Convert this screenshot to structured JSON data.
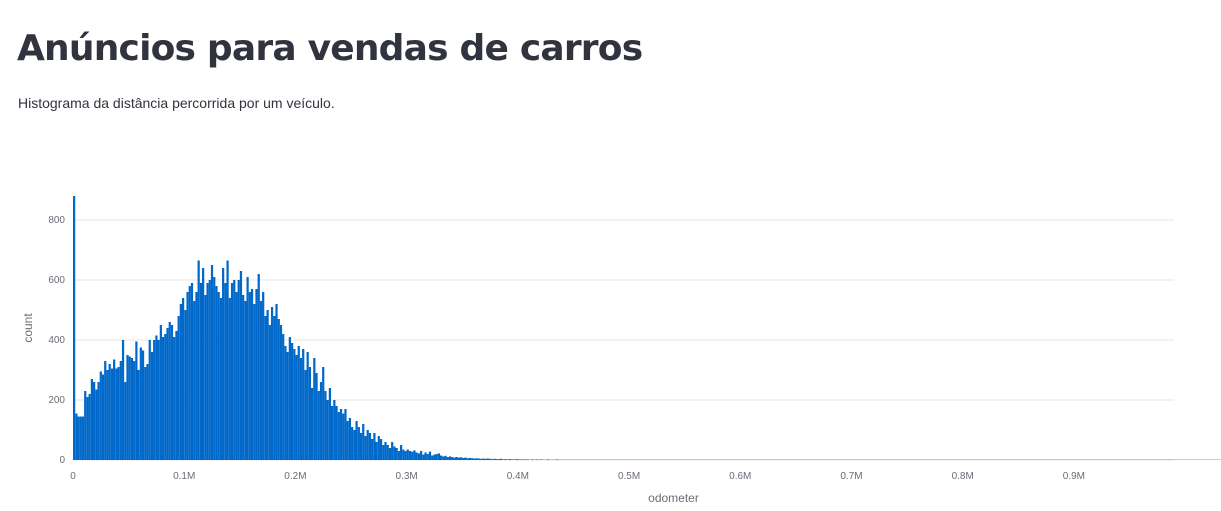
{
  "page": {
    "title": "Anúncios para vendas de carros",
    "caption": "Histograma da distância percorrida por um veículo."
  },
  "colors": {
    "bar": "#0068c9",
    "grid": "#e6e6ea",
    "text": "#31333f",
    "axis_text": "#6b6d76"
  },
  "chart_data": {
    "type": "bar",
    "title": "",
    "xlabel": "odometer",
    "ylabel": "count",
    "xlim": [
      0,
      990000
    ],
    "ylim": [
      0,
      880
    ],
    "grid": true,
    "x_ticks": [
      0,
      100000,
      200000,
      300000,
      400000,
      500000,
      600000,
      700000,
      800000,
      900000
    ],
    "x_tick_labels": [
      "0",
      "0.1M",
      "0.2M",
      "0.3M",
      "0.4M",
      "0.5M",
      "0.6M",
      "0.7M",
      "0.8M",
      "0.9M"
    ],
    "y_ticks": [
      0,
      200,
      400,
      600,
      800
    ],
    "y_tick_labels": [
      "0",
      "200",
      "400",
      "600",
      "800"
    ],
    "bin_width": 2000,
    "bin_start": 0,
    "values": [
      880,
      155,
      145,
      145,
      145,
      230,
      210,
      220,
      270,
      260,
      235,
      260,
      295,
      285,
      330,
      300,
      320,
      305,
      335,
      305,
      310,
      330,
      400,
      260,
      350,
      345,
      340,
      330,
      395,
      300,
      375,
      365,
      310,
      320,
      400,
      360,
      400,
      415,
      400,
      450,
      410,
      420,
      440,
      460,
      450,
      410,
      430,
      480,
      520,
      540,
      500,
      560,
      580,
      590,
      530,
      560,
      665,
      590,
      640,
      550,
      590,
      600,
      650,
      610,
      580,
      560,
      540,
      640,
      590,
      665,
      540,
      590,
      600,
      560,
      600,
      630,
      550,
      530,
      610,
      560,
      570,
      520,
      570,
      620,
      530,
      560,
      480,
      500,
      450,
      510,
      480,
      520,
      470,
      450,
      420,
      380,
      360,
      410,
      390,
      370,
      350,
      380,
      340,
      370,
      300,
      360,
      310,
      240,
      340,
      290,
      230,
      260,
      310,
      230,
      200,
      240,
      180,
      200,
      180,
      160,
      170,
      155,
      170,
      130,
      140,
      110,
      100,
      130,
      110,
      90,
      120,
      80,
      100,
      90,
      70,
      90,
      60,
      80,
      70,
      50,
      60,
      50,
      40,
      60,
      45,
      40,
      30,
      50,
      35,
      30,
      35,
      30,
      28,
      32,
      25,
      22,
      30,
      18,
      25,
      20,
      28,
      15,
      18,
      20,
      22,
      15,
      12,
      14,
      10,
      12,
      10,
      8,
      10,
      8,
      9,
      7,
      8,
      6,
      7,
      6,
      5,
      6,
      5,
      4,
      5,
      4,
      5,
      4,
      3,
      4,
      3,
      3,
      4,
      2,
      3,
      2,
      3,
      2,
      2,
      3,
      2,
      2,
      2,
      2,
      2,
      1,
      2,
      1,
      2,
      1,
      2,
      1,
      1,
      2,
      1,
      1,
      1,
      2,
      1,
      1,
      1,
      1,
      1,
      1,
      1,
      1,
      1,
      1,
      1,
      1,
      1,
      1,
      1,
      1,
      1,
      1,
      1,
      1,
      1,
      1,
      1,
      1,
      1,
      1,
      1,
      1,
      1,
      1,
      1,
      1,
      1,
      1,
      1,
      1,
      1,
      1,
      1,
      1,
      1,
      1,
      1,
      1,
      1,
      1,
      1,
      1,
      1,
      1,
      1,
      1,
      1,
      1,
      1,
      1,
      1,
      1,
      1,
      1,
      1,
      1,
      1,
      1,
      1,
      1,
      1,
      1,
      1,
      1,
      1,
      1,
      1,
      1,
      1,
      1,
      1,
      1,
      1,
      1,
      1,
      1,
      1,
      1,
      1,
      1,
      1,
      1,
      1,
      1,
      1,
      1,
      1,
      1,
      1,
      1,
      1,
      1,
      1,
      1,
      1,
      1,
      1,
      1,
      1,
      1,
      1,
      1,
      1,
      1,
      1,
      1,
      1,
      1,
      1,
      1,
      1,
      1,
      1,
      1,
      1,
      1,
      1,
      1,
      1,
      1,
      1,
      1,
      1,
      1,
      1,
      1,
      1,
      1,
      1,
      1,
      1,
      1,
      1,
      1,
      1,
      1,
      1,
      1,
      1,
      1,
      1,
      1,
      1,
      1,
      1,
      1,
      1,
      1,
      1,
      1,
      1,
      1,
      1,
      1,
      1,
      1,
      1,
      1,
      1,
      1,
      1,
      1,
      1,
      1,
      1,
      1,
      1,
      1,
      1,
      1,
      1,
      1,
      1,
      1,
      1,
      1,
      1,
      1,
      1,
      1,
      1,
      1,
      1,
      1,
      1,
      1,
      1,
      1,
      1,
      1,
      1,
      1,
      1,
      1,
      1,
      1,
      1,
      1,
      1,
      1,
      1,
      1,
      1,
      1,
      1,
      1,
      1,
      1,
      1,
      1,
      1,
      1,
      1,
      1,
      1,
      1,
      1,
      1,
      1,
      1,
      1,
      1,
      1,
      1,
      1,
      1,
      1,
      1,
      1,
      1,
      1,
      1,
      1,
      1,
      1,
      1,
      1,
      1,
      1,
      1,
      1,
      1,
      1,
      1,
      1,
      1,
      1,
      1,
      1,
      1,
      1,
      1,
      1,
      1,
      1,
      1,
      1,
      1,
      1,
      1,
      1,
      1,
      1,
      1,
      1,
      1,
      1,
      1,
      1,
      1,
      1,
      1,
      1,
      1,
      1,
      1,
      1,
      1,
      1,
      1,
      1,
      1,
      1,
      1,
      1,
      1,
      1,
      1,
      1,
      1,
      1,
      1,
      1,
      1,
      1,
      1,
      1,
      1,
      1,
      1,
      1,
      1,
      1,
      1,
      1,
      1
    ]
  }
}
